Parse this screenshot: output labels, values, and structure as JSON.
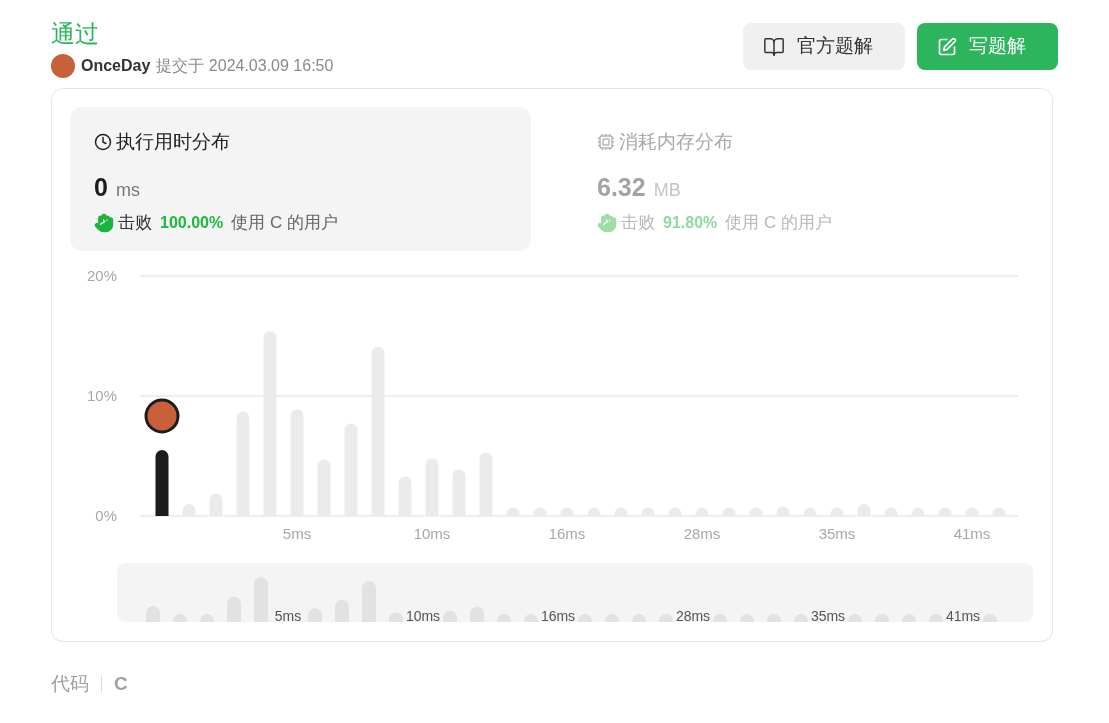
{
  "status": "通过",
  "submission": {
    "user": "OnceDay",
    "action": "提交于",
    "time": "2024.03.09 16:50"
  },
  "buttons": [
    {
      "label": "官方题解",
      "kind": "secondary"
    },
    {
      "label": "写题解",
      "kind": "primary"
    }
  ],
  "stats": [
    {
      "kind": "runtime",
      "title": "执行用时分布",
      "value": "0",
      "unit": "ms",
      "beat_label": "击败",
      "percent": "100.00%",
      "suffix": "使用 C 的用户",
      "selected": true
    },
    {
      "kind": "memory",
      "title": "消耗内存分布",
      "value": "6.32",
      "unit": "MB",
      "beat_label": "击败",
      "percent": "91.80%",
      "suffix": "使用 C 的用户",
      "selected": false
    }
  ],
  "chart_data": {
    "type": "bar",
    "ylim": [
      0,
      20
    ],
    "yticks": [
      {
        "value": 0,
        "label": "0%"
      },
      {
        "value": 10,
        "label": "10%"
      },
      {
        "value": 20,
        "label": "20%"
      }
    ],
    "series": [
      {
        "color": "#1c1c1c",
        "values": [
          5.5,
          null,
          null,
          null,
          null,
          null,
          null,
          null,
          null,
          null,
          null,
          null,
          null,
          null,
          null,
          null,
          null,
          null,
          null,
          null,
          null,
          null,
          null,
          null,
          null,
          null,
          null,
          null,
          null,
          null,
          null,
          null
        ]
      },
      {
        "color": "#ebebeb",
        "values": [
          null,
          1.0,
          1.9,
          8.7,
          15.4,
          8.9,
          4.7,
          7.7,
          14.1,
          3.3,
          4.8,
          3.9,
          5.3,
          0.7,
          0.7,
          0.7,
          0.7,
          0.7,
          0.7,
          0.7,
          0.7,
          0.7,
          0.7,
          0.8,
          0.7,
          0.7,
          1.0,
          0.7,
          0.7,
          0.7,
          0.7,
          0.7
        ]
      }
    ]
  },
  "axis_labels": [
    "5ms",
    "10ms",
    "16ms",
    "28ms",
    "35ms",
    "41ms"
  ],
  "overview": {
    "labels": [
      "5ms",
      "10ms",
      "16ms",
      "28ms",
      "35ms",
      "41ms"
    ]
  },
  "code": {
    "label": "代码",
    "language": "C"
  }
}
